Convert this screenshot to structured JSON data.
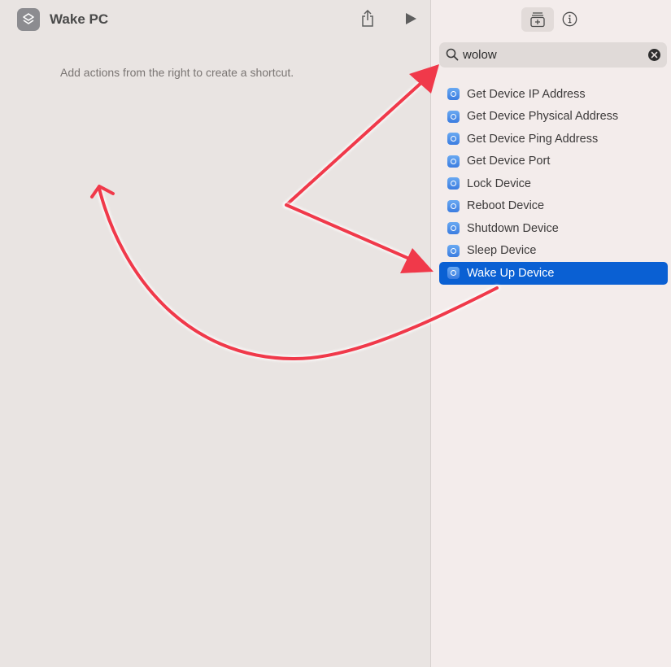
{
  "window": {
    "title": "Wake PC"
  },
  "editor": {
    "hint": "Add actions from the right to create a shortcut."
  },
  "search": {
    "value": "wolow"
  },
  "results": [
    {
      "label": "Get Device IP Address",
      "selected": false
    },
    {
      "label": "Get Device Physical Address",
      "selected": false
    },
    {
      "label": "Get Device Ping Address",
      "selected": false
    },
    {
      "label": "Get Device Port",
      "selected": false
    },
    {
      "label": "Lock Device",
      "selected": false
    },
    {
      "label": "Reboot Device",
      "selected": false
    },
    {
      "label": "Shutdown Device",
      "selected": false
    },
    {
      "label": "Sleep Device",
      "selected": false
    },
    {
      "label": "Wake Up Device",
      "selected": true
    }
  ],
  "icons": {
    "app": "shortcuts-app-icon",
    "share": "share-icon",
    "run": "play-icon",
    "library": "action-library-icon",
    "info": "info-icon",
    "search": "search-icon",
    "clear": "clear-icon",
    "action": "device-action-icon"
  },
  "colors": {
    "selection": "#0a60d3",
    "annotation_arrow": "#f0394a",
    "sidebar_bg": "#f3eceb",
    "editor_bg": "#e9e4e2"
  }
}
